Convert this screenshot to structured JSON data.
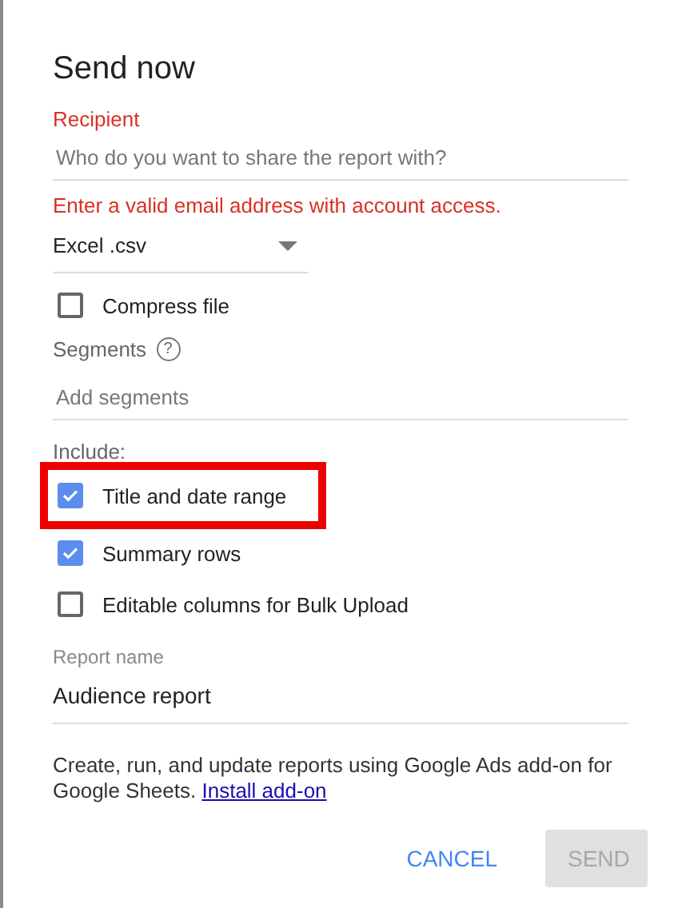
{
  "dialog": {
    "title": "Send now"
  },
  "recipient": {
    "label": "Recipient",
    "placeholder": "Who do you want to share the report with?",
    "error": "Enter a valid email address with account access."
  },
  "format": {
    "value": "Excel .csv"
  },
  "compress": {
    "label": "Compress file",
    "checked": false
  },
  "segments": {
    "label": "Segments",
    "help_icon": "?",
    "placeholder": "Add segments"
  },
  "include": {
    "label": "Include:",
    "items": [
      {
        "label": "Title and date range",
        "checked": true,
        "highlighted": true
      },
      {
        "label": "Summary rows",
        "checked": true,
        "highlighted": false
      },
      {
        "label": "Editable columns for Bulk Upload",
        "checked": false,
        "highlighted": false
      }
    ]
  },
  "report_name": {
    "label": "Report name",
    "value": "Audience report"
  },
  "note": {
    "text": "Create, run, and update reports using Google Ads add-on for Google Sheets.",
    "link": "Install add-on"
  },
  "buttons": [
    {
      "label": "CANCEL",
      "disabled": false,
      "kind": "text"
    },
    {
      "label": "SEND",
      "disabled": true,
      "kind": "filled"
    }
  ]
}
